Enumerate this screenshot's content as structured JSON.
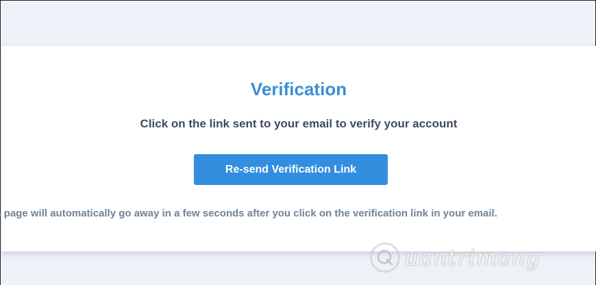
{
  "verification": {
    "title": "Verification",
    "subtitle": "Click on the link sent to your email to verify your account",
    "resend_button_label": "Re-send Verification Link",
    "note": "is page will automatically go away in a few seconds after you click on the verification link in your email."
  },
  "watermark": {
    "text": "uantrimang",
    "icon": "quantrimang-logo-icon"
  },
  "colors": {
    "accent": "#338ee0",
    "title": "#3b8fd6",
    "page_background": "#eef2f8",
    "card_background": "#ffffff"
  }
}
